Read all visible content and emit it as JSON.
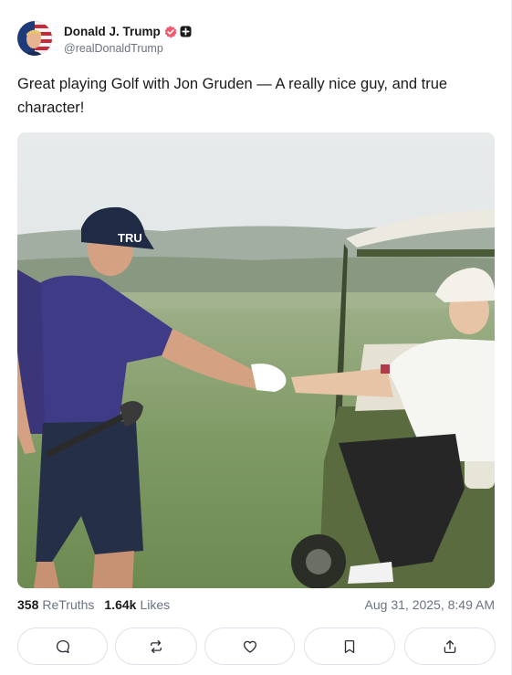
{
  "post": {
    "author": {
      "display_name": "Donald J. Trump",
      "handle": "@realDonaldTrump",
      "verified": true,
      "badge_icon": "plus-square-icon"
    },
    "text": "Great playing Golf with Jon Gruden — A really nice guy, and true character!",
    "image": {
      "cap_text": "TRU"
    },
    "stats": {
      "retruths_count": "358",
      "retruths_label": "ReTruths",
      "likes_count": "1.64k",
      "likes_label": "Likes",
      "timestamp": "Aug 31, 2025, 8:49 AM"
    },
    "actions": [
      {
        "name": "reply",
        "icon": "comment-icon"
      },
      {
        "name": "retruth",
        "icon": "repost-icon"
      },
      {
        "name": "like",
        "icon": "heart-icon"
      },
      {
        "name": "bookmark",
        "icon": "bookmark-icon"
      },
      {
        "name": "share",
        "icon": "share-icon"
      }
    ]
  },
  "colors": {
    "verified_badge": "#ef5b6e",
    "text_primary": "#1a1a1a",
    "text_muted": "#6b7280",
    "border": "#dfe2e8"
  }
}
